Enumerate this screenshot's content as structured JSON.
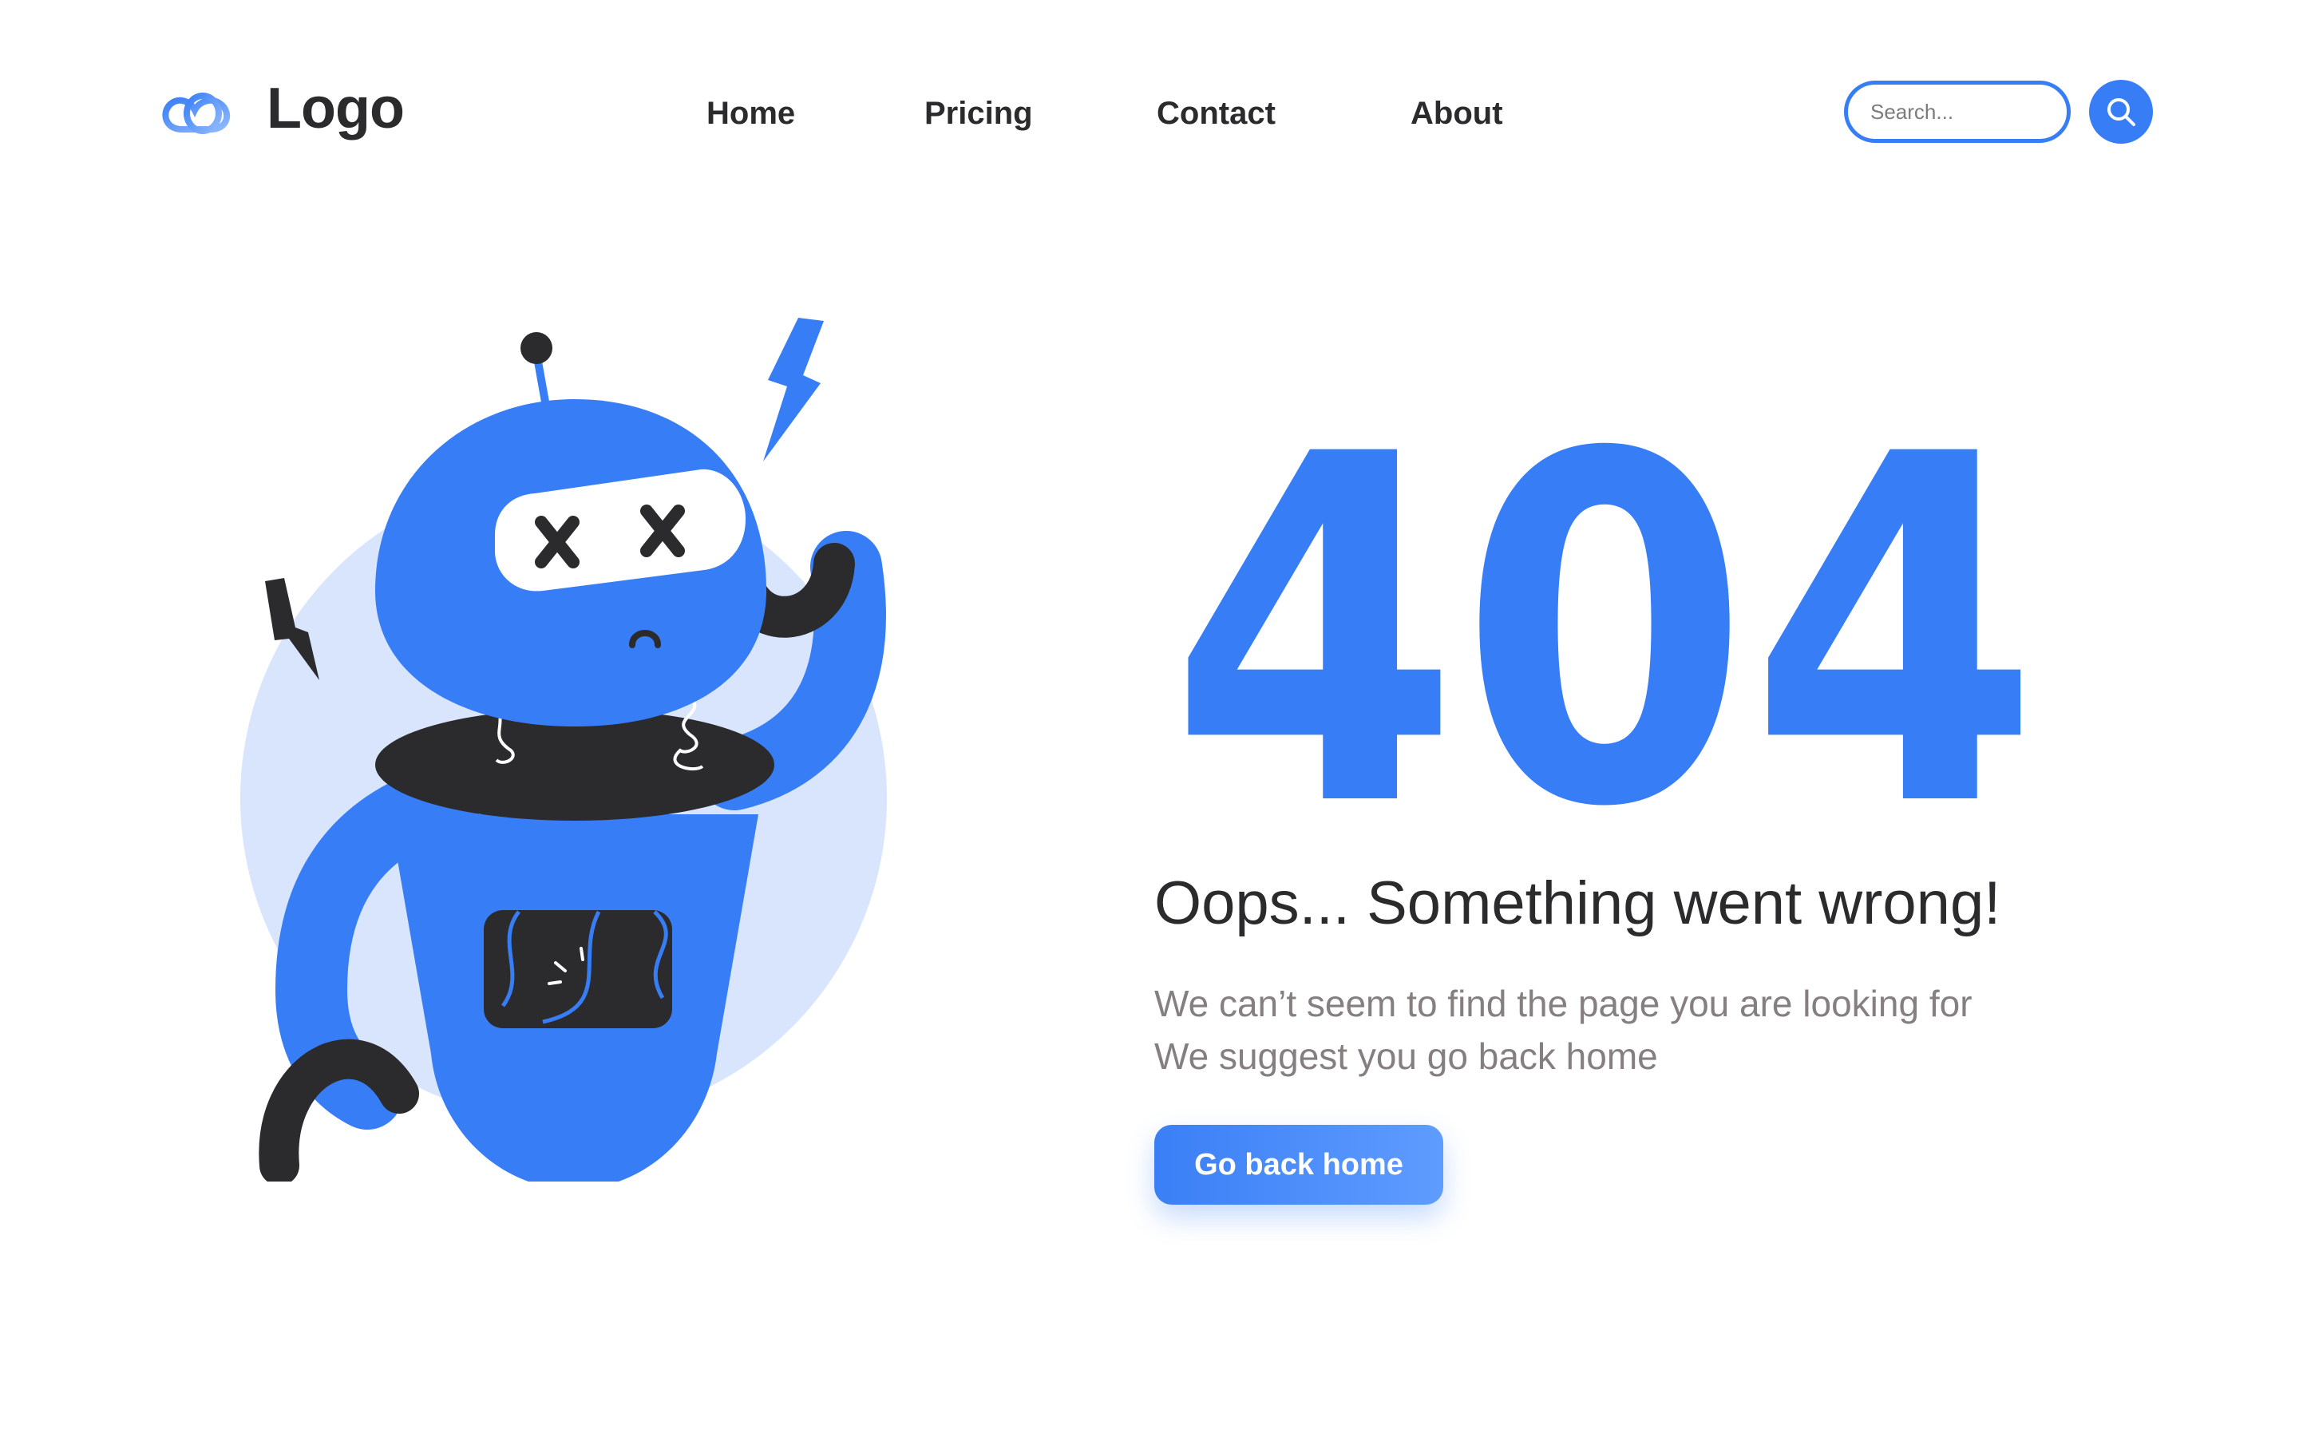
{
  "header": {
    "logo_text": "Logo",
    "logo_icon": "cloud-rings-icon",
    "nav": [
      {
        "label": "Home"
      },
      {
        "label": "Pricing"
      },
      {
        "label": "Contact"
      },
      {
        "label": "About"
      }
    ],
    "search": {
      "placeholder": "Search...",
      "value": "",
      "button_icon": "search-icon"
    }
  },
  "error": {
    "code": "404",
    "title": "Oops... Something went wrong!",
    "message_lines": [
      "We can’t seem to find the page you are looking for",
      "We suggest you go back home"
    ],
    "button_label": "Go back home"
  },
  "illustration": {
    "subject": "broken-robot-illustration",
    "icons": [
      "lightning-icon",
      "cross-eyes-icon",
      "sad-mouth-icon"
    ]
  },
  "colors": {
    "accent": "#377ef6",
    "accent_light": "#d8e5fd",
    "dark": "#2b2b2e",
    "muted_text": "#857f80",
    "background": "#ffffff"
  }
}
